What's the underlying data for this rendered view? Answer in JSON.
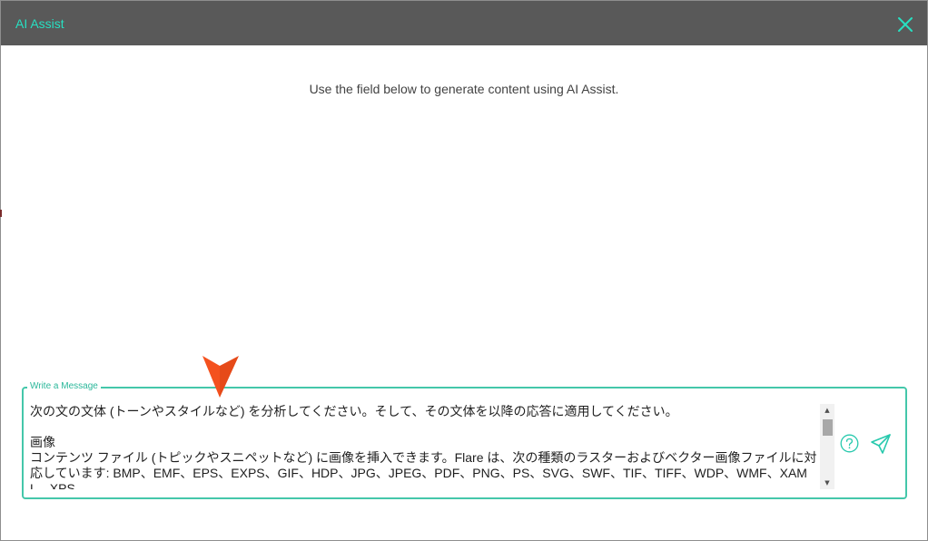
{
  "dialog": {
    "title": "AI Assist",
    "close_icon": "close-icon",
    "instructions": "Use the field below to generate content using AI Assist."
  },
  "composer": {
    "legend": "Write a Message",
    "message": "次の文の文体 (トーンやスタイルなど) を分析してください。そして、その文体を以降の応答に適用してください。\n\n画像\nコンテンツ ファイル (トピックやスニペットなど) に画像を挿入できます。Flare は、次の種類のラスターおよびベクター画像ファイルに対応しています: BMP、EMF、EPS、EXPS、GIF、HDP、JPG、JPEG、PDF、PNG、PS、SVG、SWF、TIF、TIFF、WDP、WMF、XAML、XPS",
    "help_icon": "question-circle-icon",
    "send_icon": "send-icon"
  },
  "colors": {
    "titlebar": "#595959",
    "accent": "#27e0c2",
    "border": "#44c7aa",
    "pointer": "#f4511e"
  }
}
